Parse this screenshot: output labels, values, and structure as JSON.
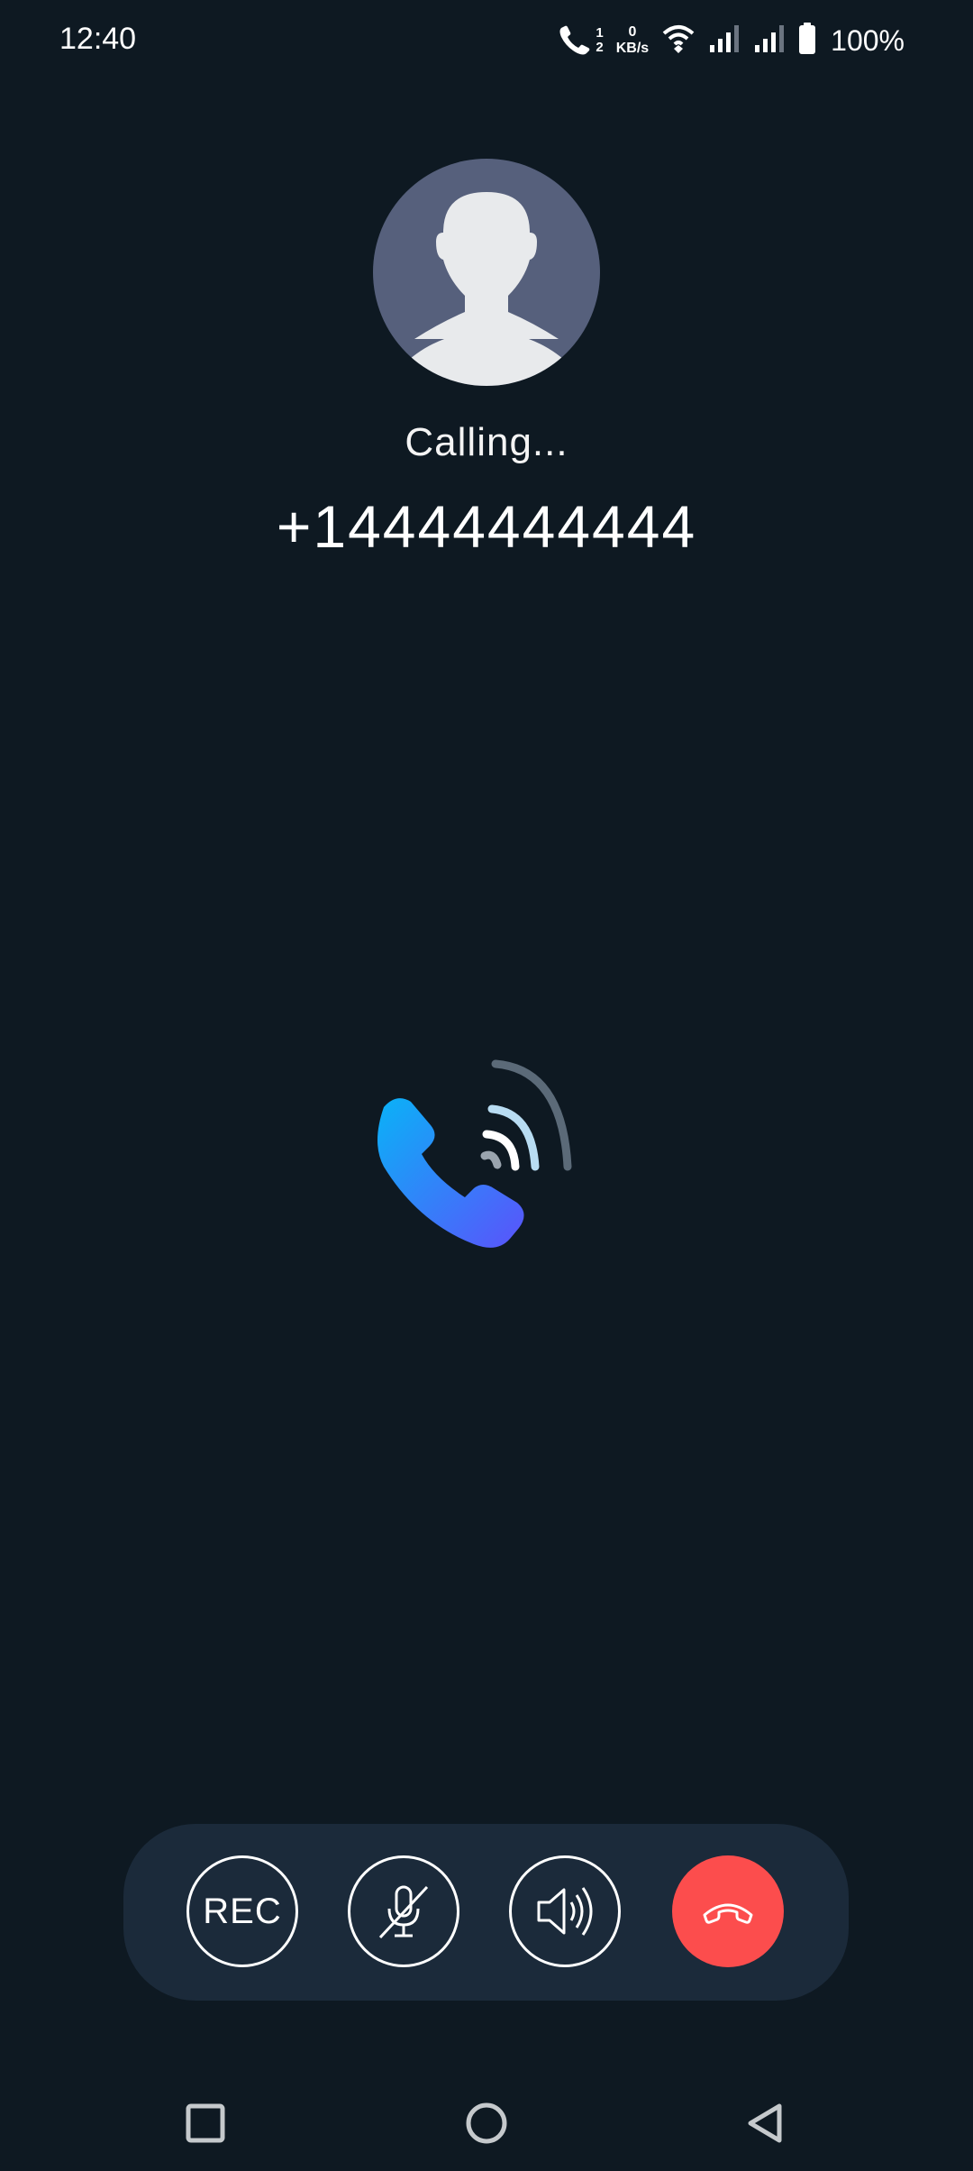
{
  "status_bar": {
    "time": "12:40",
    "call_sim_top": "1",
    "call_sim_bottom": "2",
    "net_speed_value": "0",
    "net_speed_unit": "KB/s",
    "battery": "100%",
    "icons": [
      "call-sim-icon",
      "wifi-icon",
      "signal-icon",
      "signal-icon",
      "battery-icon"
    ]
  },
  "call": {
    "status": "Calling...",
    "number": "+14444444444"
  },
  "controls": {
    "rec_label": "REC",
    "icons": [
      "mute-mic-icon",
      "speaker-icon",
      "end-call-icon"
    ]
  },
  "navigation": {
    "icons": [
      "recents-icon",
      "home-icon",
      "back-icon"
    ]
  },
  "colors": {
    "background": "#0e1922",
    "panel": "#1b2a3a",
    "avatar_bg": "#56607c",
    "end_call": "#fc4d4d",
    "phone_gradient_start": "#0ab2f7",
    "phone_gradient_end": "#5a53fb"
  }
}
